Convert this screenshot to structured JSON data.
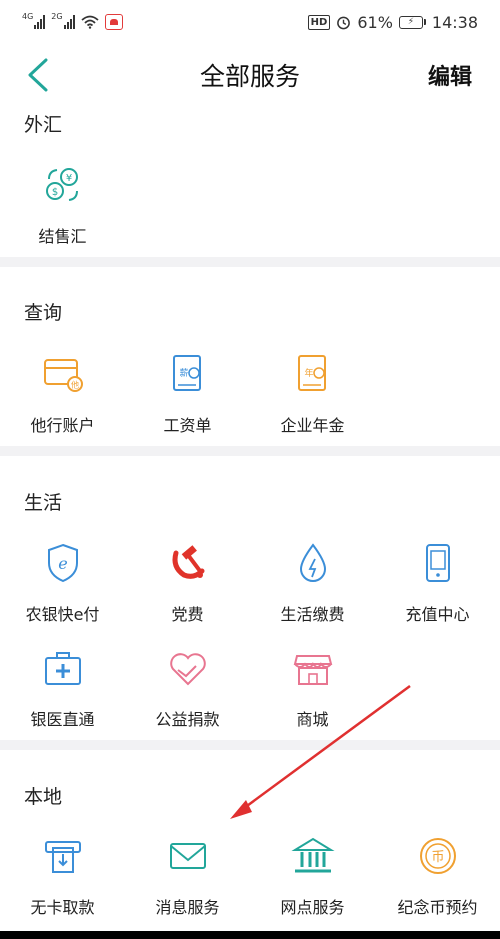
{
  "status_bar": {
    "net1": "4G",
    "net2": "2G",
    "hd": "HD",
    "battery_pct": "61%",
    "time": "14:38"
  },
  "header": {
    "title": "全部服务",
    "edit": "编辑"
  },
  "sections": {
    "forex": {
      "title": "外汇",
      "items": [
        {
          "label": "结售汇",
          "icon": "currency-exchange-icon"
        }
      ]
    },
    "query": {
      "title": "查询",
      "items": [
        {
          "label": "他行账户",
          "icon": "bank-card-icon"
        },
        {
          "label": "工资单",
          "icon": "salary-slip-icon"
        },
        {
          "label": "企业年金",
          "icon": "annuity-icon"
        }
      ]
    },
    "life": {
      "title": "生活",
      "items": [
        {
          "label": "农银快e付",
          "icon": "shield-e-icon"
        },
        {
          "label": "党费",
          "icon": "hammer-sickle-icon"
        },
        {
          "label": "生活缴费",
          "icon": "water-drop-icon"
        },
        {
          "label": "充值中心",
          "icon": "phone-recharge-icon"
        },
        {
          "label": "银医直通",
          "icon": "medical-box-icon"
        },
        {
          "label": "公益捐款",
          "icon": "charity-heart-icon"
        },
        {
          "label": "商城",
          "icon": "store-icon"
        }
      ]
    },
    "local": {
      "title": "本地",
      "items": [
        {
          "label": "无卡取款",
          "icon": "cardless-withdraw-icon"
        },
        {
          "label": "消息服务",
          "icon": "message-envelope-icon"
        },
        {
          "label": "网点服务",
          "icon": "bank-branch-icon"
        },
        {
          "label": "纪念币预约",
          "icon": "commemorative-coin-icon"
        }
      ]
    }
  },
  "colors": {
    "teal": "#22a69a",
    "orange": "#f0a030",
    "blue": "#3b8ed8",
    "red": "#e0332a",
    "pink": "#e87590",
    "arrow": "#e03030",
    "divider": "#f2f2f4"
  }
}
